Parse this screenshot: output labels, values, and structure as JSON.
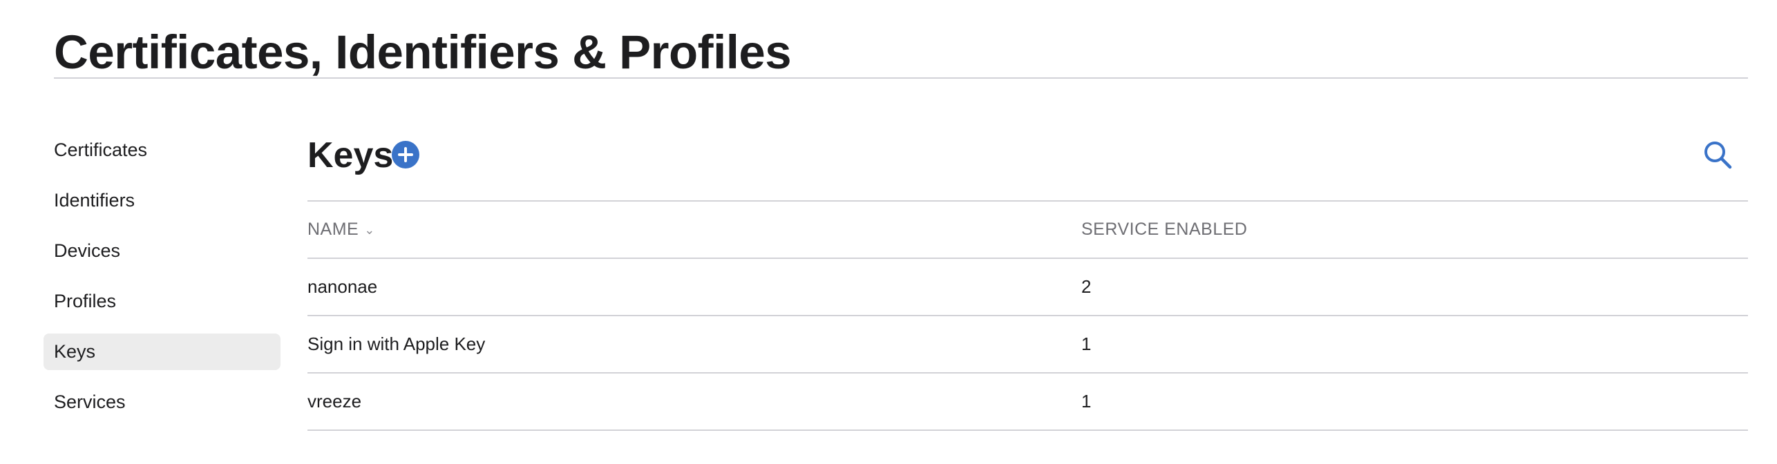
{
  "page": {
    "title": "Certificates, Identifiers & Profiles"
  },
  "sidebar": {
    "items": [
      {
        "label": "Certificates",
        "active": false
      },
      {
        "label": "Identifiers",
        "active": false
      },
      {
        "label": "Devices",
        "active": false
      },
      {
        "label": "Profiles",
        "active": false
      },
      {
        "label": "Keys",
        "active": true
      },
      {
        "label": "Services",
        "active": false
      }
    ]
  },
  "main": {
    "section_title": "Keys",
    "add_icon": "plus-circle-icon",
    "search_icon": "search-icon",
    "table": {
      "columns": [
        {
          "label": "NAME",
          "sort_icon": "chevron-down-icon"
        },
        {
          "label": "SERVICE ENABLED"
        }
      ],
      "rows": [
        {
          "name": "nanonae",
          "services": "2"
        },
        {
          "name": "Sign in with Apple Key",
          "services": "1"
        },
        {
          "name": "vreeze",
          "services": "1"
        }
      ]
    }
  },
  "colors": {
    "accent": "#3a73c8",
    "active_item_bg": "#ececec",
    "divider": "#d2d2d7",
    "muted_text": "#6e6e73"
  }
}
